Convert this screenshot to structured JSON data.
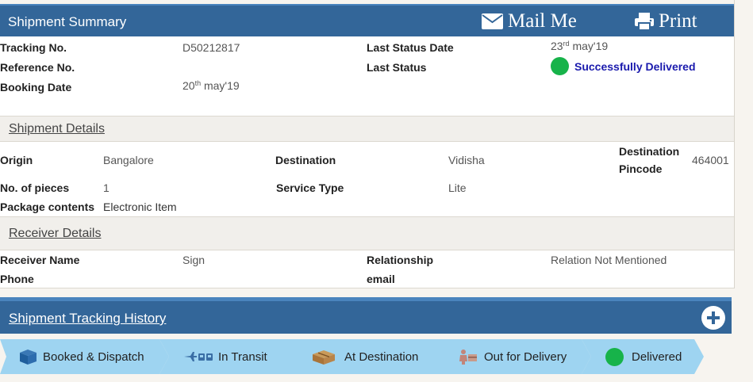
{
  "header": {
    "title": "Shipment Summary",
    "mail_label": "Mail Me",
    "print_label": "Print"
  },
  "summary": {
    "tracking_label": "Tracking No.",
    "tracking_value": "D50212817",
    "reference_label": "Reference No.",
    "reference_value": "",
    "booking_label": "Booking Date",
    "booking_day": "20",
    "booking_sup": "th",
    "booking_rest": " may'19",
    "last_status_date_label": "Last Status Date",
    "last_status_day": "23",
    "last_status_sup": "rd",
    "last_status_rest": " may'19",
    "last_status_label": "Last Status",
    "last_status_value": "Successfully Delivered",
    "status_color": "#17b34a"
  },
  "shipment_details": {
    "title": "Shipment Details",
    "origin_label": "Origin",
    "origin_value": "Bangalore",
    "destination_label": "Destination",
    "destination_value": "Vidisha",
    "dest_pincode_label_1": "Destination",
    "dest_pincode_label_2": "Pincode",
    "dest_pincode_value": "464001",
    "pieces_label": "No. of pieces",
    "pieces_value": "1",
    "service_label": "Service Type",
    "service_value": "Lite",
    "contents_label": "Package contents",
    "contents_value": "Electronic Item"
  },
  "receiver_details": {
    "title": "Receiver Details",
    "name_label": "Receiver Name",
    "name_value": "Sign",
    "relationship_label": "Relationship",
    "relationship_value": "Relation Not Mentioned",
    "phone_label": "Phone",
    "email_label": "email"
  },
  "history": {
    "title": "Shipment Tracking History"
  },
  "steps": [
    {
      "label": "Booked & Dispatch",
      "icon": "box-icon"
    },
    {
      "label": "In Transit",
      "icon": "transport-icon"
    },
    {
      "label": "At Destination",
      "icon": "package-icon"
    },
    {
      "label": "Out for Delivery",
      "icon": "delivery-icon"
    },
    {
      "label": "Delivered",
      "icon": "delivered-dot-icon"
    }
  ],
  "colors": {
    "header_blue": "#336699",
    "step_blue": "#9ed4f1",
    "delivered_green": "#17b34a",
    "status_text": "#1a1aad"
  }
}
